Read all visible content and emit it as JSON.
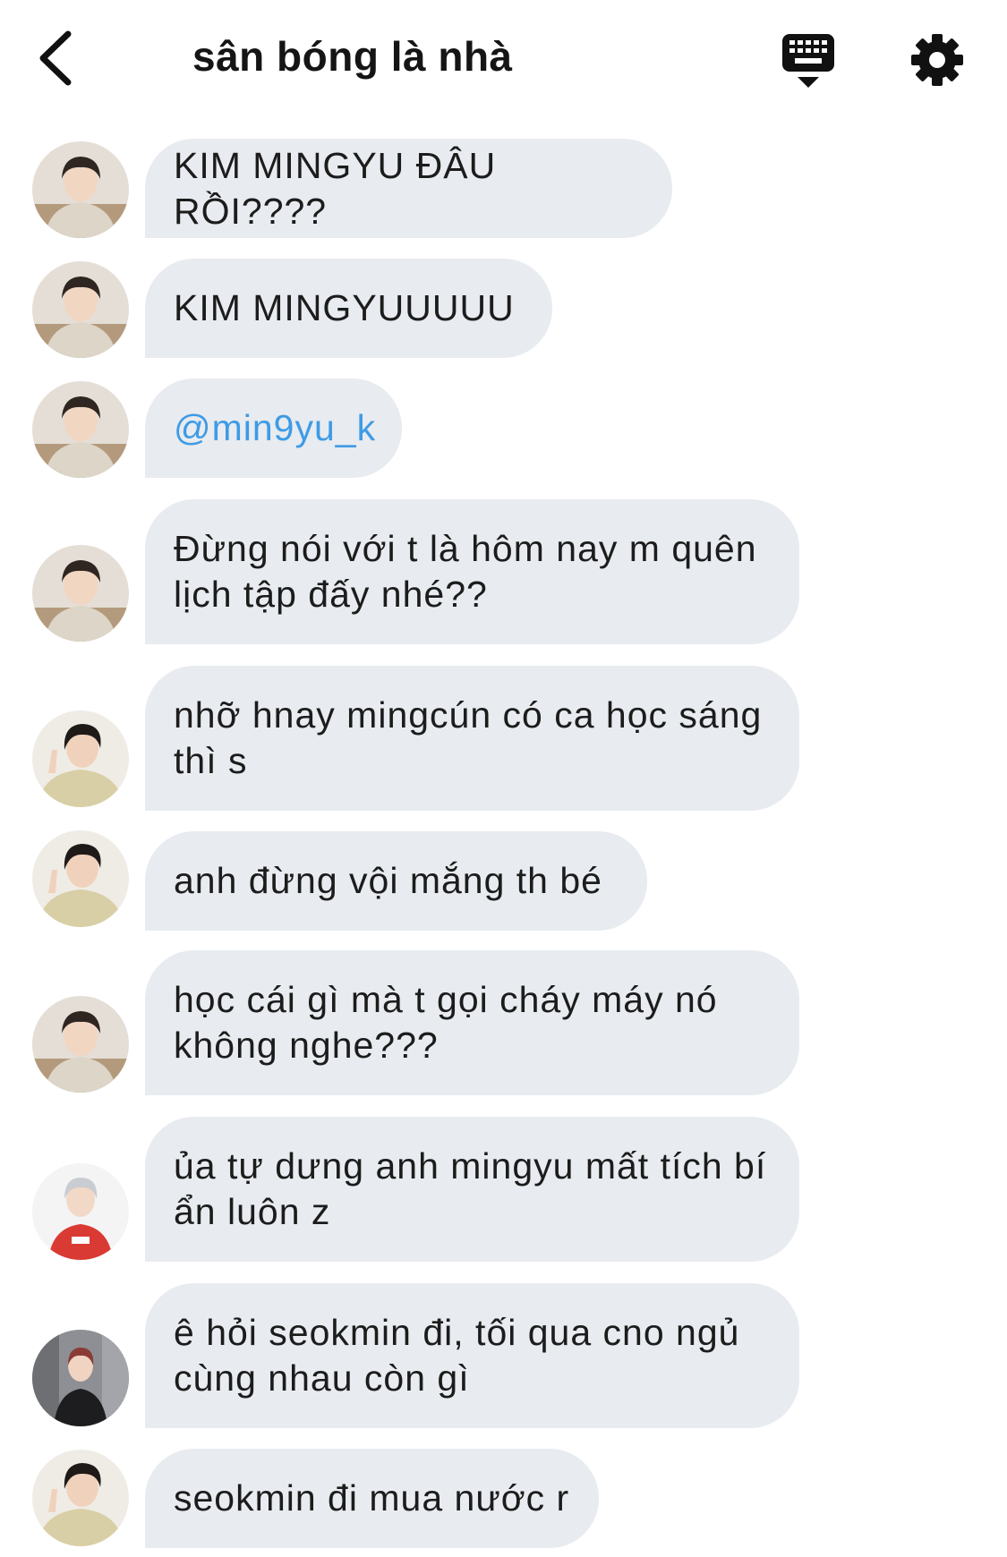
{
  "header": {
    "title": "sân bóng là nhà",
    "back_icon": "chevron-left-icon",
    "keyboard_icon": "keyboard-icon",
    "settings_icon": "gear-icon"
  },
  "colors": {
    "bubble_bg": "#e8ebef",
    "mention": "#3e9be6",
    "text": "#1c1c1c"
  },
  "messages": [
    {
      "sender": "beige-shirt",
      "text": "KIM MINGYU ĐÂU RỒI????"
    },
    {
      "sender": "beige-shirt",
      "text": "KIM MINGYUUUUU"
    },
    {
      "sender": "beige-shirt",
      "text": "@min9yu_k",
      "mention": true
    },
    {
      "sender": "beige-shirt",
      "text": "Đừng nói với t là hôm nay m quên lịch tập đấy nhé??"
    },
    {
      "sender": "fleece-jacket",
      "text": "nhỡ hnay mingcún có ca học sáng thì s"
    },
    {
      "sender": "fleece-jacket",
      "text": "anh đừng vội mắng th bé"
    },
    {
      "sender": "beige-shirt",
      "text": "học cái gì mà t gọi cháy máy nó không nghe???"
    },
    {
      "sender": "red-jersey",
      "text": "ủa tự dưng anh mingyu mất tích bí ẩn luôn z"
    },
    {
      "sender": "black-jacket",
      "text": "ê hỏi seokmin đi, tối qua cno ngủ cùng nhau còn gì"
    },
    {
      "sender": "fleece-jacket",
      "text": "seokmin đi mua nước r"
    }
  ]
}
